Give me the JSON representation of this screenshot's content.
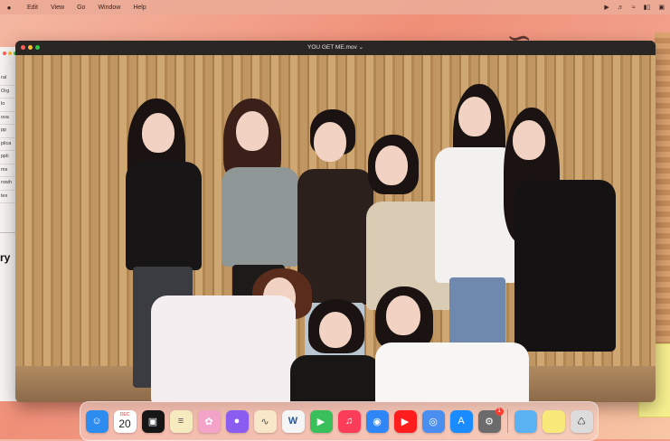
{
  "menubar": {
    "items": [
      "Edit",
      "View",
      "Go",
      "Window",
      "Help"
    ],
    "status_icons": [
      "play-icon",
      "volume-icon",
      "wifi-icon",
      "battery-icon",
      "display-icon"
    ]
  },
  "background_window": {
    "list_items": [
      "ral",
      "Org",
      "lo",
      "ova",
      "pp",
      "plica",
      "ppli",
      "ms",
      "rowh",
      "tes"
    ],
    "big_text": "ry"
  },
  "player": {
    "title": "YOU GET ME.mov ⌄"
  },
  "dock": {
    "apps": [
      {
        "name": "Finder",
        "icon": "finder-icon",
        "color": "#2d8cf0",
        "glyph": "☺"
      },
      {
        "name": "Calendar",
        "icon": "calendar-icon",
        "color": "#ffffff",
        "month": "DEC",
        "day": "20"
      },
      {
        "name": "Notchmeister",
        "icon": "black-square-icon",
        "color": "#161616",
        "glyph": "▣"
      },
      {
        "name": "Notes",
        "icon": "notes-icon",
        "color": "#f6ebbf",
        "glyph": "≡"
      },
      {
        "name": "Photos",
        "icon": "photos-icon",
        "color": "#f3a3c8",
        "glyph": "✿"
      },
      {
        "name": "Siri",
        "icon": "siri-icon",
        "color": "#8a5cf0",
        "glyph": "●"
      },
      {
        "name": "Freeform",
        "icon": "freeform-icon",
        "color": "#f8e7c8",
        "glyph": "∿"
      },
      {
        "name": "Word",
        "icon": "word-icon",
        "color": "#f5f5f5",
        "glyph": "W"
      },
      {
        "name": "FaceTime",
        "icon": "facetime-icon",
        "color": "#3ac05a",
        "glyph": "▶"
      },
      {
        "name": "Music",
        "icon": "music-icon",
        "color": "#fc3d5a",
        "glyph": "♫"
      },
      {
        "name": "Safari",
        "icon": "safari-icon",
        "color": "#2f86f6",
        "glyph": "◉"
      },
      {
        "name": "YouTube",
        "icon": "youtube-icon",
        "color": "#ff1e1e",
        "glyph": "▶"
      },
      {
        "name": "Chrome",
        "icon": "chrome-icon",
        "color": "#4a8ef0",
        "glyph": "◎"
      },
      {
        "name": "App Store",
        "icon": "app-store-icon",
        "color": "#1a8cff",
        "glyph": "A"
      },
      {
        "name": "System Settings",
        "icon": "settings-icon",
        "color": "#6b6b6b",
        "glyph": "⚙",
        "badge": "1"
      },
      {
        "name": "Downloads",
        "icon": "folder-icon",
        "color": "#5ab2f2",
        "glyph": ""
      },
      {
        "name": "Stickies",
        "icon": "stickies-icon",
        "color": "#f7ea7b",
        "glyph": ""
      },
      {
        "name": "Trash",
        "icon": "trash-icon",
        "color": "#dcdcdc",
        "glyph": "♺"
      }
    ]
  },
  "colors": {
    "menubar": "#ecaa96",
    "player_chrome": "#2a2624",
    "wall_slats": "#c09663"
  }
}
